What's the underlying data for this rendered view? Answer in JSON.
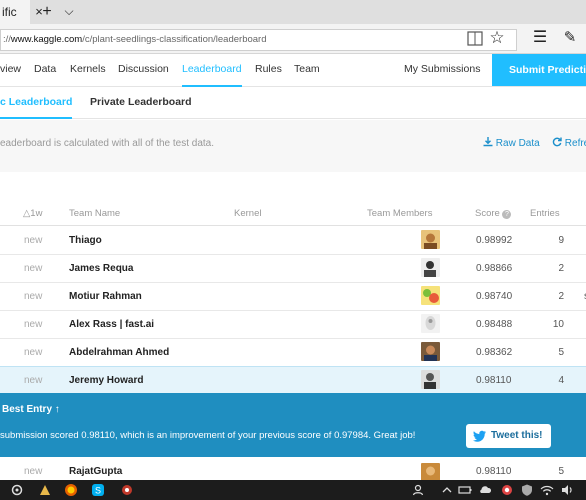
{
  "browser": {
    "tab_title": "ific",
    "tab_close_glyph": "×",
    "tab_new_glyph": "+",
    "tab_list_glyph": "⌵",
    "url_prefix": "://",
    "url_host": "www.kaggle.com",
    "url_path": "/c/plant-seedlings-classification/leaderboard",
    "favorites_glyph": "☆",
    "hub_glyph": "☰",
    "note_glyph": "✎"
  },
  "nav": {
    "items": [
      "view",
      "Data",
      "Kernels",
      "Discussion",
      "Leaderboard",
      "Rules",
      "Team"
    ],
    "my_submissions": "My Submissions",
    "submit": "Submit Predictio"
  },
  "subnav": {
    "public": "c Leaderboard",
    "private": "Private Leaderboard"
  },
  "info": {
    "text": "eaderboard is calculated with all of the test data.",
    "raw_data": "Raw Data",
    "refresh": "Refre"
  },
  "table": {
    "headers": {
      "change": "△1w",
      "team": "Team Name",
      "kernel": "Kernel",
      "members": "Team Members",
      "score": "Score",
      "entries": "Entries"
    },
    "rows": [
      {
        "change": "new",
        "team": "Thiago",
        "score": "0.98992",
        "entries": "9",
        "extra": ""
      },
      {
        "change": "new",
        "team": "James Requa",
        "score": "0.98866",
        "entries": "2",
        "extra": ""
      },
      {
        "change": "new",
        "team": "Motiur Rahman",
        "score": "0.98740",
        "entries": "2",
        "extra": "s"
      },
      {
        "change": "new",
        "team": "Alex Rass | fast.ai",
        "score": "0.98488",
        "entries": "10",
        "extra": ""
      },
      {
        "change": "new",
        "team": "Abdelrahman Ahmed",
        "score": "0.98362",
        "entries": "5",
        "extra": ""
      },
      {
        "change": "new",
        "team": "Jeremy Howard",
        "score": "0.98110",
        "entries": "4",
        "extra": ""
      },
      {
        "change": "new",
        "team": "RajatGupta",
        "score": "0.98110",
        "entries": "5",
        "extra": ""
      }
    ]
  },
  "banner": {
    "title": "Best Entry",
    "arrow": "↑",
    "message": "submission scored 0.98110, which is an improvement of your previous score of 0.97984. Great job!",
    "tweet": "Tweet this!"
  },
  "colors": {
    "accent": "#20beff",
    "banner": "#1f8ec0",
    "link": "#1b8fcb"
  }
}
